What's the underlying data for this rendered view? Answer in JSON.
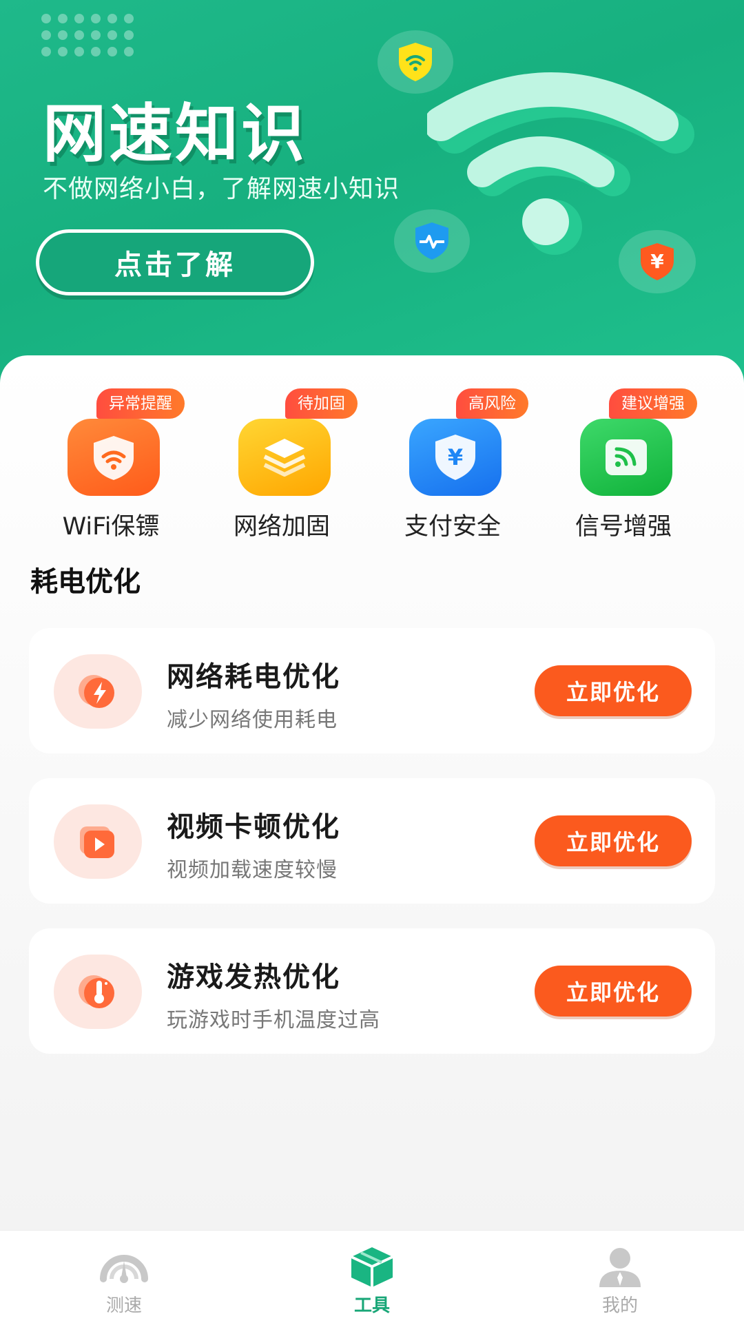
{
  "banner": {
    "title": "网速知识",
    "subtitle": "不做网络小白，了解网速小知识",
    "button_label": "点击了解"
  },
  "tools": [
    {
      "label": "WiFi保镖",
      "badge": "异常提醒",
      "icon": "wifi-shield-icon",
      "color": "#ff6a1f"
    },
    {
      "label": "网络加固",
      "badge": "待加固",
      "icon": "layers-icon",
      "color": "#ffb300"
    },
    {
      "label": "支付安全",
      "badge": "高风险",
      "icon": "yuan-shield-icon",
      "color": "#1e86f5"
    },
    {
      "label": "信号增强",
      "badge": "建议增强",
      "icon": "signal-icon",
      "color": "#1fc04a"
    }
  ],
  "section_title": "耗电优化",
  "optimizations": [
    {
      "title": "网络耗电优化",
      "subtitle": "减少网络使用耗电",
      "button": "立即优化",
      "icon": "lightning-icon"
    },
    {
      "title": "视频卡顿优化",
      "subtitle": "视频加载速度较慢",
      "button": "立即优化",
      "icon": "video-play-icon"
    },
    {
      "title": "游戏发热优化",
      "subtitle": "玩游戏时手机温度过高",
      "button": "立即优化",
      "icon": "thermometer-icon"
    }
  ],
  "tabbar": [
    {
      "label": "测速",
      "icon": "speedometer-icon",
      "active": false
    },
    {
      "label": "工具",
      "icon": "toolbox-icon",
      "active": true
    },
    {
      "label": "我的",
      "icon": "user-icon",
      "active": false
    }
  ],
  "colors": {
    "brand_green": "#17b07f",
    "accent_orange": "#fb5a1e",
    "tab_active": "#18a677"
  }
}
